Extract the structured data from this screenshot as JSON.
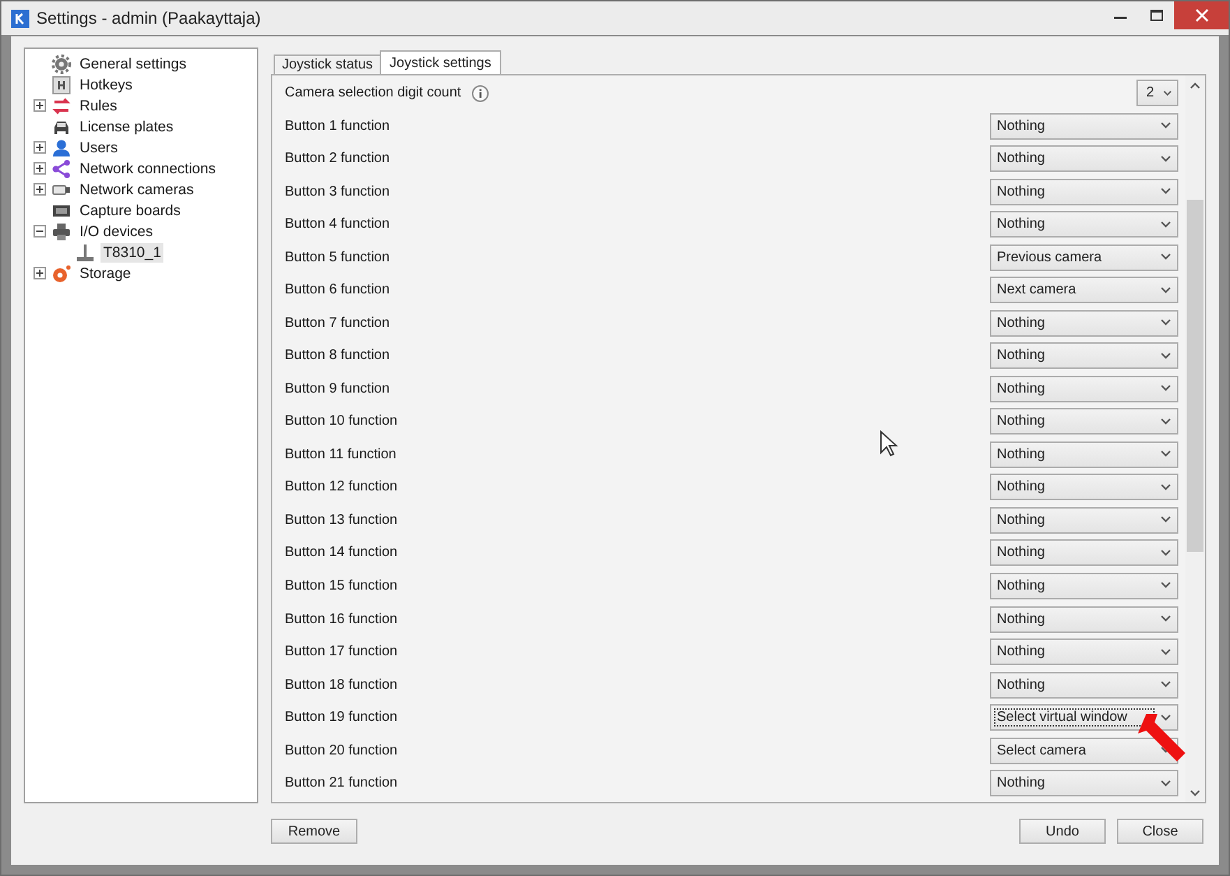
{
  "window": {
    "title": "Settings - admin (Paakayttaja)"
  },
  "sidebar": {
    "items": [
      {
        "label": "General settings",
        "selected": false
      },
      {
        "label": "Hotkeys",
        "selected": false
      },
      {
        "label": "Rules",
        "expanded": false,
        "selected": false
      },
      {
        "label": "License plates",
        "selected": false
      },
      {
        "label": "Users",
        "expanded": false,
        "selected": false
      },
      {
        "label": "Network connections",
        "expanded": false,
        "selected": false
      },
      {
        "label": "Network cameras",
        "expanded": false,
        "selected": false
      },
      {
        "label": "Capture boards",
        "selected": false
      },
      {
        "label": "I/O devices",
        "expanded": true,
        "selected": false,
        "children": [
          {
            "label": "T8310_1",
            "selected": true
          }
        ]
      },
      {
        "label": "Storage",
        "expanded": false,
        "selected": false
      }
    ]
  },
  "tabs": [
    {
      "label": "Joystick status",
      "selected": false
    },
    {
      "label": "Joystick settings",
      "selected": true
    }
  ],
  "settings": [
    {
      "kind": "count",
      "label": "Camera selection digit count",
      "value": "2",
      "focused": false
    },
    {
      "kind": "function",
      "label": "Button 1 function",
      "value": "Nothing",
      "focused": false
    },
    {
      "kind": "function",
      "label": "Button 2 function",
      "value": "Nothing",
      "focused": false
    },
    {
      "kind": "function",
      "label": "Button 3 function",
      "value": "Nothing",
      "focused": false
    },
    {
      "kind": "function",
      "label": "Button 4 function",
      "value": "Nothing",
      "focused": false
    },
    {
      "kind": "function",
      "label": "Button 5 function",
      "value": "Previous camera",
      "focused": false
    },
    {
      "kind": "function",
      "label": "Button 6 function",
      "value": "Next camera",
      "focused": false
    },
    {
      "kind": "function",
      "label": "Button 7 function",
      "value": "Nothing",
      "focused": false
    },
    {
      "kind": "function",
      "label": "Button 8 function",
      "value": "Nothing",
      "focused": false
    },
    {
      "kind": "function",
      "label": "Button 9 function",
      "value": "Nothing",
      "focused": false
    },
    {
      "kind": "function",
      "label": "Button 10 function",
      "value": "Nothing",
      "focused": false
    },
    {
      "kind": "function",
      "label": "Button 11 function",
      "value": "Nothing",
      "focused": false
    },
    {
      "kind": "function",
      "label": "Button 12 function",
      "value": "Nothing",
      "focused": false
    },
    {
      "kind": "function",
      "label": "Button 13 function",
      "value": "Nothing",
      "focused": false
    },
    {
      "kind": "function",
      "label": "Button 14 function",
      "value": "Nothing",
      "focused": false
    },
    {
      "kind": "function",
      "label": "Button 15 function",
      "value": "Nothing",
      "focused": false
    },
    {
      "kind": "function",
      "label": "Button 16 function",
      "value": "Nothing",
      "focused": false
    },
    {
      "kind": "function",
      "label": "Button 17 function",
      "value": "Nothing",
      "focused": false
    },
    {
      "kind": "function",
      "label": "Button 18 function",
      "value": "Nothing",
      "focused": false
    },
    {
      "kind": "function",
      "label": "Button 19 function",
      "value": "Select virtual window",
      "focused": true
    },
    {
      "kind": "function",
      "label": "Button 20 function",
      "value": "Select camera",
      "focused": false
    },
    {
      "kind": "function",
      "label": "Button 21 function",
      "value": "Nothing",
      "focused": false
    }
  ],
  "buttons": {
    "left": [
      "Remove"
    ],
    "right": [
      "Undo",
      "Close"
    ]
  }
}
